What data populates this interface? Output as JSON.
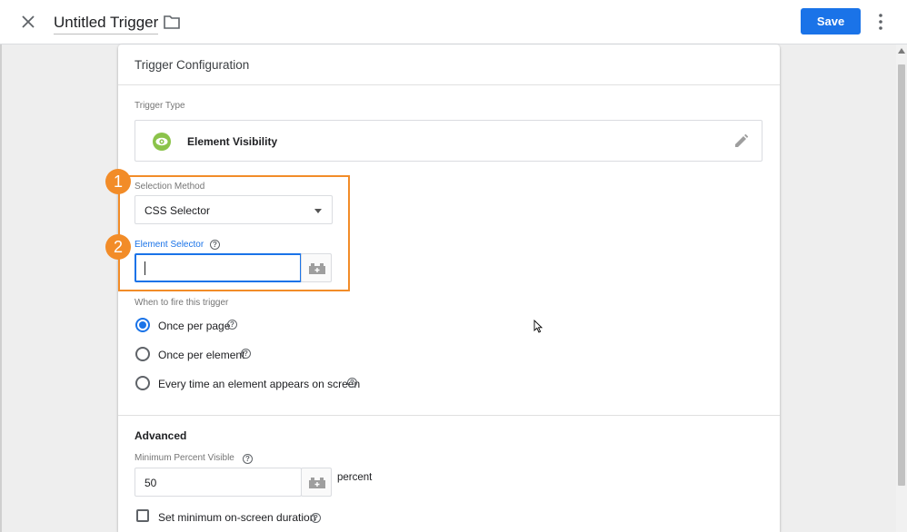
{
  "header": {
    "title": "Untitled Trigger",
    "save_label": "Save"
  },
  "card": {
    "title": "Trigger Configuration",
    "trigger_type_label": "Trigger Type",
    "trigger_type_name": "Element Visibility",
    "selection_method_label": "Selection Method",
    "selection_method_value": "CSS Selector",
    "element_selector_label": "Element Selector",
    "element_selector_value": "",
    "fire_label": "When to fire this trigger",
    "fire_options": [
      {
        "label": "Once per page",
        "selected": true
      },
      {
        "label": "Once per element",
        "selected": false
      },
      {
        "label": "Every time an element appears on screen",
        "selected": false
      }
    ],
    "advanced_title": "Advanced",
    "min_percent_label": "Minimum Percent Visible",
    "min_percent_value": "50",
    "percent_unit": "percent",
    "min_duration_label": "Set minimum on-screen duration",
    "min_duration_checked": false
  },
  "callouts": [
    "1",
    "2"
  ],
  "help_glyph": "?",
  "colors": {
    "accent": "#1a73e8",
    "highlight": "#f28c28",
    "trigger_icon": "#8bc34a"
  }
}
